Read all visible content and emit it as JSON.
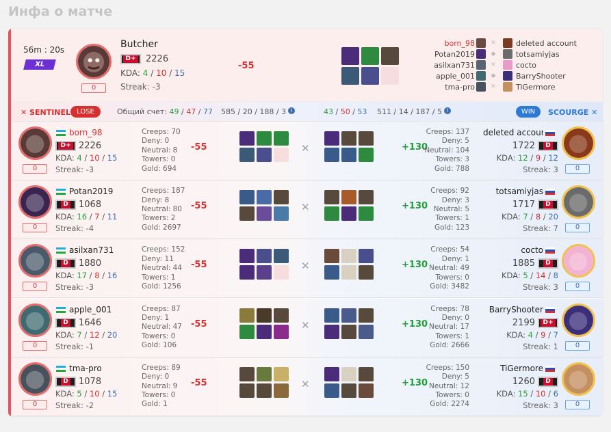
{
  "page": {
    "title": "Инфа о матче"
  },
  "summary": {
    "duration": "56m : 20s",
    "mode": "XL",
    "player": {
      "name": "Butcher",
      "rank": "D+",
      "mmr": "2226",
      "kda_label": "KDA:",
      "k": "4",
      "d": "10",
      "a": "15",
      "streak": "Streak: -3",
      "counter": "0"
    },
    "delta": "-55",
    "roster": [
      {
        "left": "born_98",
        "right": "deleted account"
      },
      {
        "left": "Potan2019",
        "right": "totsamiyjas"
      },
      {
        "left": "asilxan731",
        "right": "cocto"
      },
      {
        "left": "apple_001",
        "right": "BarryShooter"
      },
      {
        "left": "tma-pro",
        "right": "TiGermore"
      }
    ]
  },
  "scorebar": {
    "sentinel": "SENTINEL",
    "lose": "LOSE",
    "total_label": "Общий счет:",
    "s_k": "49",
    "s_d": "47",
    "s_a": "77",
    "s_extra": "585 / 20 / 188 / 3",
    "w_k": "43",
    "w_d": "50",
    "w_a": "53",
    "w_extra": "511 / 14 / 187 / 5",
    "win": "WIN",
    "scourge": "SCOURGE"
  },
  "rows": [
    {
      "left": {
        "name": "born_98",
        "rank": "D+",
        "mmr": "2226",
        "k": "4",
        "d": "10",
        "a": "15",
        "streak": "Streak: -3",
        "counter": "0",
        "creeps": "Creeps: 70",
        "deny": "Deny: 0",
        "neutral": "Neutral: 8",
        "towers": "Towers: 0",
        "gold": "Gold: 694",
        "delta": "-55"
      },
      "right": {
        "name": "deleted account",
        "rank": "D",
        "mmr": "1722",
        "k": "12",
        "d": "9",
        "a": "12",
        "streak": "Streak: 3",
        "counter": "0",
        "creeps": "Creeps: 137",
        "deny": "Deny: 5",
        "neutral": "Neutral: 104",
        "towers": "Towers: 3",
        "gold": "Gold: 788",
        "delta": "+130"
      }
    },
    {
      "left": {
        "name": "Potan2019",
        "rank": "D",
        "mmr": "1068",
        "k": "16",
        "d": "7",
        "a": "11",
        "streak": "Streak: -4",
        "counter": "0",
        "creeps": "Creeps: 187",
        "deny": "Deny: 8",
        "neutral": "Neutral: 80",
        "towers": "Towers: 2",
        "gold": "Gold: 2697",
        "delta": "-55"
      },
      "right": {
        "name": "totsamiyjas",
        "rank": "D",
        "mmr": "1717",
        "k": "7",
        "d": "8",
        "a": "20",
        "streak": "Streak: 7",
        "counter": "0",
        "creeps": "Creeps: 92",
        "deny": "Deny: 3",
        "neutral": "Neutral: 5",
        "towers": "Towers: 1",
        "gold": "Gold: 123",
        "delta": "+130"
      }
    },
    {
      "left": {
        "name": "asilxan731",
        "rank": "D",
        "mmr": "1880",
        "k": "17",
        "d": "8",
        "a": "16",
        "streak": "Streak: -3",
        "counter": "0",
        "creeps": "Creeps: 152",
        "deny": "Deny: 11",
        "neutral": "Neutral: 44",
        "towers": "Towers: 1",
        "gold": "Gold: 1256",
        "delta": "-55"
      },
      "right": {
        "name": "cocto",
        "rank": "D",
        "mmr": "1885",
        "k": "5",
        "d": "14",
        "a": "8",
        "streak": "Streak: 3",
        "counter": "0",
        "creeps": "Creeps: 54",
        "deny": "Deny: 1",
        "neutral": "Neutral: 49",
        "towers": "Towers: 0",
        "gold": "Gold: 3482",
        "delta": "+130"
      }
    },
    {
      "left": {
        "name": "apple_001",
        "rank": "D",
        "mmr": "1646",
        "k": "7",
        "d": "12",
        "a": "20",
        "streak": "Streak: -1",
        "counter": "0",
        "creeps": "Creeps: 87",
        "deny": "Deny: 1",
        "neutral": "Neutral: 47",
        "towers": "Towers: 0",
        "gold": "Gold: 106",
        "delta": "-55"
      },
      "right": {
        "name": "BarryShooter",
        "rank": "D+",
        "mmr": "2199",
        "k": "4",
        "d": "9",
        "a": "7",
        "streak": "Streak: 1",
        "counter": "0",
        "creeps": "Creeps: 78",
        "deny": "Deny: 0",
        "neutral": "Neutral: 17",
        "towers": "Towers: 1",
        "gold": "Gold: 2666",
        "delta": "+130"
      }
    },
    {
      "left": {
        "name": "tma-pro",
        "rank": "D",
        "mmr": "1078",
        "k": "5",
        "d": "10",
        "a": "15",
        "streak": "Streak: -2",
        "counter": "0",
        "creeps": "Creeps: 89",
        "deny": "Deny: 0",
        "neutral": "Neutral: 9",
        "towers": "Towers: 0",
        "gold": "Gold: 1",
        "delta": "-55"
      },
      "right": {
        "name": "TiGermore",
        "rank": "D",
        "mmr": "1260",
        "k": "15",
        "d": "10",
        "a": "6",
        "streak": "Streak: 3",
        "counter": "0",
        "creeps": "Creeps: 150",
        "deny": "Deny: 5",
        "neutral": "Neutral: 12",
        "towers": "Towers: 0",
        "gold": "Gold: 2274",
        "delta": "+130"
      }
    }
  ],
  "labels": {
    "kda": "KDA:"
  },
  "icons": {
    "cross": "crossed-swords-icon",
    "info": "info-icon",
    "shield": "shield-icon"
  },
  "colors": {
    "loss": "#d62f2f",
    "win": "#2d79d4",
    "accent": "#6c2fd6",
    "positive": "#1e9e3a"
  }
}
